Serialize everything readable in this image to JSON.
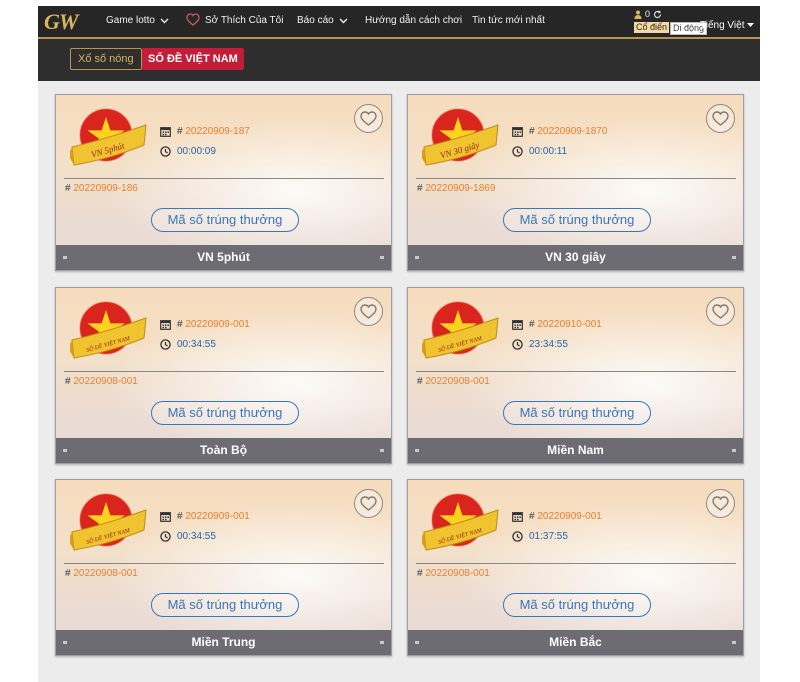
{
  "header": {
    "logo": "GW",
    "nav": [
      {
        "label": "Game lotto",
        "has_dropdown": true,
        "icon": "chevron-down-icon"
      },
      {
        "label": "Sở Thích Của Tôi",
        "has_dropdown": false,
        "icon": "heart-icon"
      },
      {
        "label": "Báo cáo",
        "has_dropdown": true,
        "icon": "chevron-down-icon"
      },
      {
        "label": "Hướng dẫn cách chơi",
        "has_dropdown": false
      },
      {
        "label": "Tin tức mới nhất",
        "has_dropdown": false
      }
    ],
    "user": {
      "balance": "0",
      "mode_classic": "Cổ điển",
      "mode_mobile": "Di động",
      "language": "Tiếng Việt"
    }
  },
  "subnav": {
    "hot_label": "Xổ số nóng",
    "active_label": "SỐ ĐỀ VIỆT NAM"
  },
  "cards": [
    {
      "name": "VN 5phút",
      "badge_text": "VN 5phút",
      "current_draw": "20220909-187",
      "countdown": "00:00:09",
      "last_draw": "20220909-186",
      "prize_button": "Mã số trúng thưởng"
    },
    {
      "name": "VN 30 giây",
      "badge_text": "VN 30 giây",
      "current_draw": "20220909-1870",
      "countdown": "00:00:11",
      "last_draw": "20220909-1869",
      "prize_button": "Mã số trúng thưởng"
    },
    {
      "name": "Toàn Bộ",
      "badge_text": "SỐ ĐỀ VIỆT NAM",
      "current_draw": "20220909-001",
      "countdown": "00:34:55",
      "last_draw": "20220908-001",
      "prize_button": "Mã số trúng thưởng"
    },
    {
      "name": "Miền Nam",
      "badge_text": "SỐ ĐỀ VIỆT NAM",
      "current_draw": "20220910-001",
      "countdown": "23:34:55",
      "last_draw": "20220908-001",
      "prize_button": "Mã số trúng thưởng"
    },
    {
      "name": "Miền Trung",
      "badge_text": "SỐ ĐỀ VIỆT NAM",
      "current_draw": "20220909-001",
      "countdown": "00:34:55",
      "last_draw": "20220908-001",
      "prize_button": "Mã số trúng thưởng"
    },
    {
      "name": "Miền Bắc",
      "badge_text": "SỐ ĐỀ VIỆT NAM",
      "current_draw": "20220909-001",
      "countdown": "01:37:55",
      "last_draw": "20220908-001",
      "prize_button": "Mã số trúng thưởng"
    }
  ],
  "symbols": {
    "hash": "#"
  },
  "colors": {
    "draw_number": "#e8802c",
    "timer": "#2563a8",
    "accent_gold": "#d8b660",
    "active_tab": "#c21e3a",
    "footer_bar": "#6d6c73"
  }
}
